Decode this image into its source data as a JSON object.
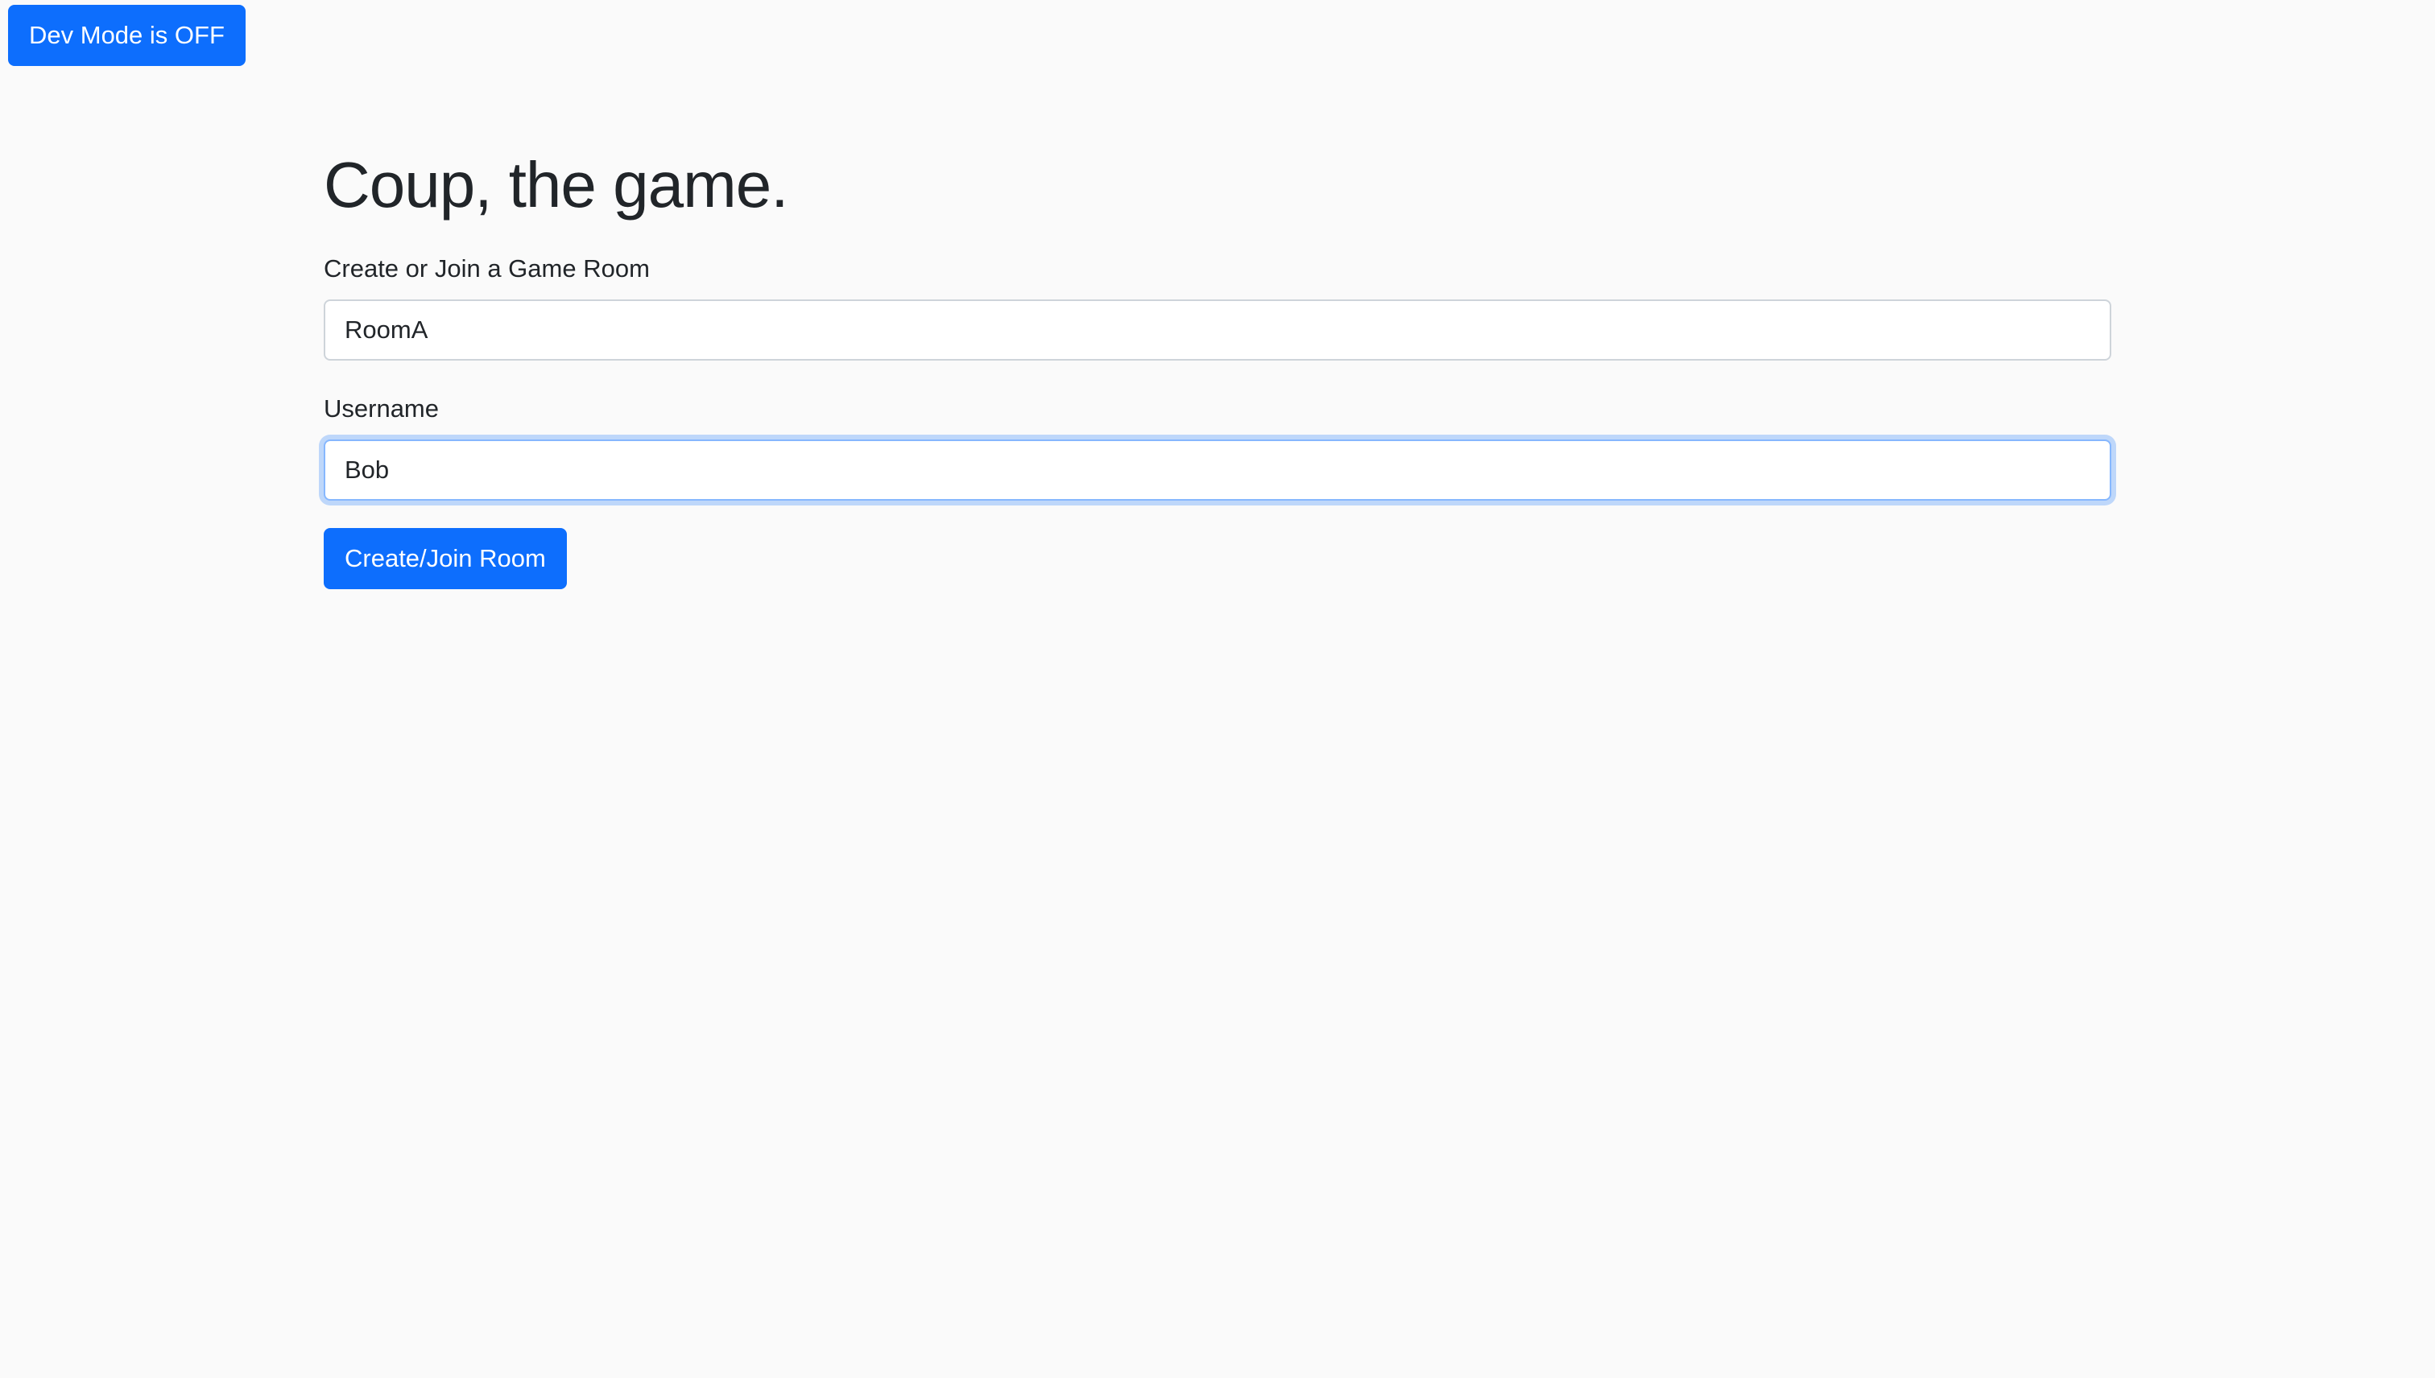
{
  "dev_mode": {
    "button_label": "Dev Mode is OFF"
  },
  "main": {
    "title": "Coup, the game.",
    "room_field": {
      "label": "Create or Join a Game Room",
      "value": "RoomA"
    },
    "username_field": {
      "label": "Username",
      "value": "Bob"
    },
    "submit_label": "Create/Join Room"
  },
  "colors": {
    "primary": "#0d6efd",
    "background": "#fafafa",
    "text": "#212529",
    "focus_border": "#86b7fe"
  }
}
